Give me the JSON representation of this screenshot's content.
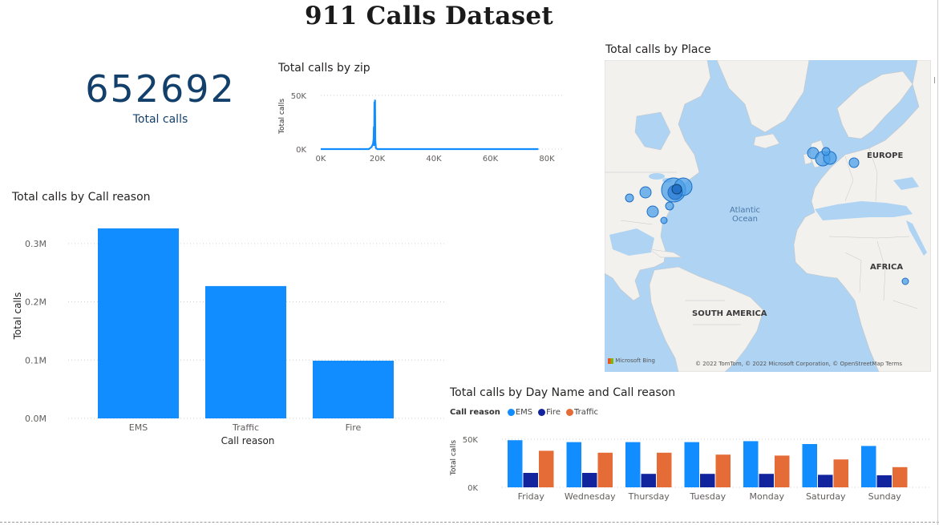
{
  "page": {
    "title": "911 Calls Dataset"
  },
  "kpi": {
    "value": "652692",
    "label": "Total calls"
  },
  "zip_chart": {
    "title": "Total calls by zip",
    "ylabel": "Total calls",
    "y_ticks": [
      "50K",
      "0K"
    ],
    "x_ticks": [
      "0K",
      "20K",
      "40K",
      "60K",
      "80K"
    ],
    "color": "#118dff"
  },
  "reason_chart": {
    "title": "Total calls by Call reason",
    "xlabel": "Call reason",
    "ylabel": "Total calls",
    "y_ticks": [
      "0.3M",
      "0.2M",
      "0.1M",
      "0.0M"
    ],
    "color": "#118dff"
  },
  "map": {
    "title": "Total calls by Place",
    "labels": {
      "europe": "EUROPE",
      "africa": "AFRICA",
      "south_america": "SOUTH AMERICA",
      "ocean_line1": "Atlantic",
      "ocean_line2": "Ocean"
    },
    "attribution": "© 2022 TomTom, © 2022 Microsoft Corporation, © OpenStreetMap  Terms",
    "bing": "Microsoft Bing",
    "land_color": "#f2f1ee",
    "water_color": "#aed3f3",
    "bubble_color": "#4a9fe8"
  },
  "day_chart": {
    "title": "Total calls by Day Name and Call reason",
    "legend_title": "Call reason",
    "ylabel": "Total calls",
    "y_ticks": [
      "50K",
      "0K"
    ]
  },
  "chart_data": [
    {
      "type": "line",
      "title": "Total calls by zip",
      "xlabel": "",
      "ylabel": "Total calls",
      "xlim": [
        0,
        80000
      ],
      "ylim": [
        0,
        50000
      ],
      "grid": true,
      "series": [
        {
          "x": [
            0,
            17000,
            18000,
            18500,
            18700,
            18800,
            18900,
            19000,
            19100,
            19200,
            19300,
            19500,
            20000,
            77000
          ],
          "values": [
            0,
            0,
            2000,
            5000,
            9000,
            21000,
            3000,
            44000,
            24000,
            46000,
            8000,
            1000,
            0,
            0
          ]
        }
      ]
    },
    {
      "type": "bar",
      "title": "Total calls by Call reason",
      "xlabel": "Call reason",
      "ylabel": "Total calls",
      "categories": [
        "EMS",
        "Traffic",
        "Fire"
      ],
      "values": [
        326000,
        227000,
        99000
      ],
      "ylim": [
        0,
        330000
      ],
      "grid": true
    },
    {
      "type": "bar",
      "title": "Total calls by Day Name and Call reason",
      "xlabel": "",
      "ylabel": "Total calls",
      "categories": [
        "Friday",
        "Wednesday",
        "Thursday",
        "Tuesday",
        "Monday",
        "Saturday",
        "Sunday"
      ],
      "series": [
        {
          "name": "EMS",
          "color": "#118dff",
          "values": [
            49000,
            47000,
            47000,
            47000,
            48000,
            45000,
            43000
          ]
        },
        {
          "name": "Fire",
          "color": "#12239e",
          "values": [
            15000,
            15000,
            14000,
            14000,
            14000,
            13000,
            12500
          ]
        },
        {
          "name": "Traffic",
          "color": "#e66c37",
          "values": [
            38000,
            36000,
            36000,
            34000,
            33000,
            29000,
            21000
          ]
        }
      ],
      "ylim": [
        0,
        50000
      ],
      "legend": "top-left",
      "grid": true
    }
  ]
}
